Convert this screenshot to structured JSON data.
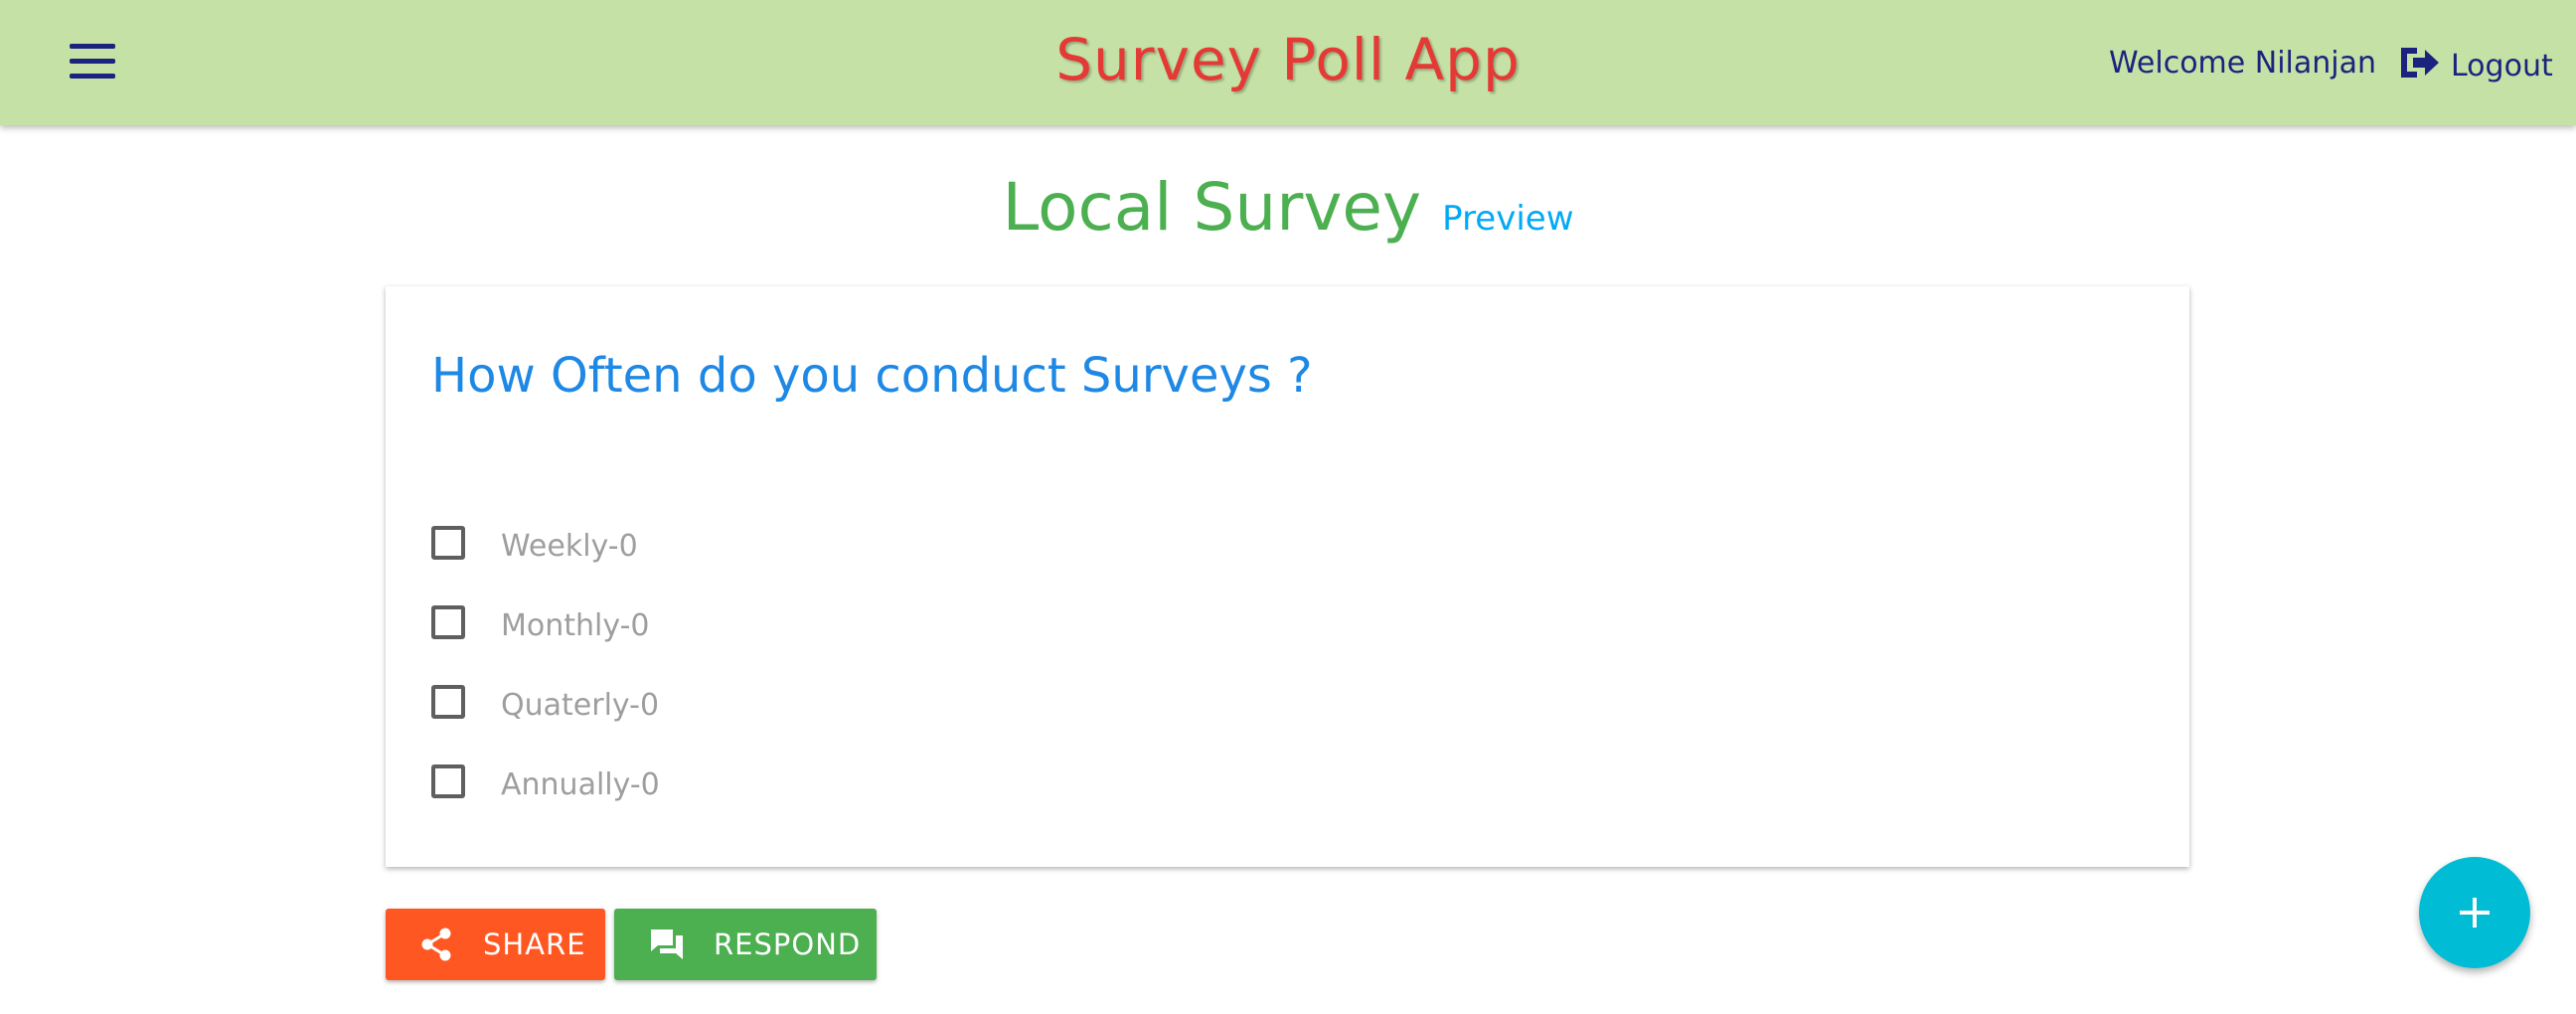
{
  "header": {
    "app_title": "Survey Poll App",
    "welcome_text": "Welcome Nilanjan",
    "logout_label": "Logout",
    "menu_icon": "hamburger-menu-icon",
    "logout_icon": "sign-out-icon"
  },
  "survey": {
    "title": "Local Survey",
    "preview_label": "Preview",
    "question": "How Often do you conduct Surveys ?",
    "options": [
      {
        "label": "Weekly-0",
        "checked": false
      },
      {
        "label": "Monthly-0",
        "checked": false
      },
      {
        "label": "Quaterly-0",
        "checked": false
      },
      {
        "label": "Annually-0",
        "checked": false
      }
    ]
  },
  "actions": {
    "share_label": "SHARE",
    "respond_label": "RESPOND",
    "share_icon": "share-icon",
    "respond_icon": "forum-icon",
    "fab_icon": "plus-icon"
  },
  "colors": {
    "header_bg": "#c5e1a5",
    "app_title": "#e53935",
    "survey_title": "#4caf50",
    "preview_link": "#03a9f4",
    "question": "#1e88e5",
    "share_button": "#ff5722",
    "respond_button": "#4caf50",
    "fab": "#00bcd4"
  }
}
